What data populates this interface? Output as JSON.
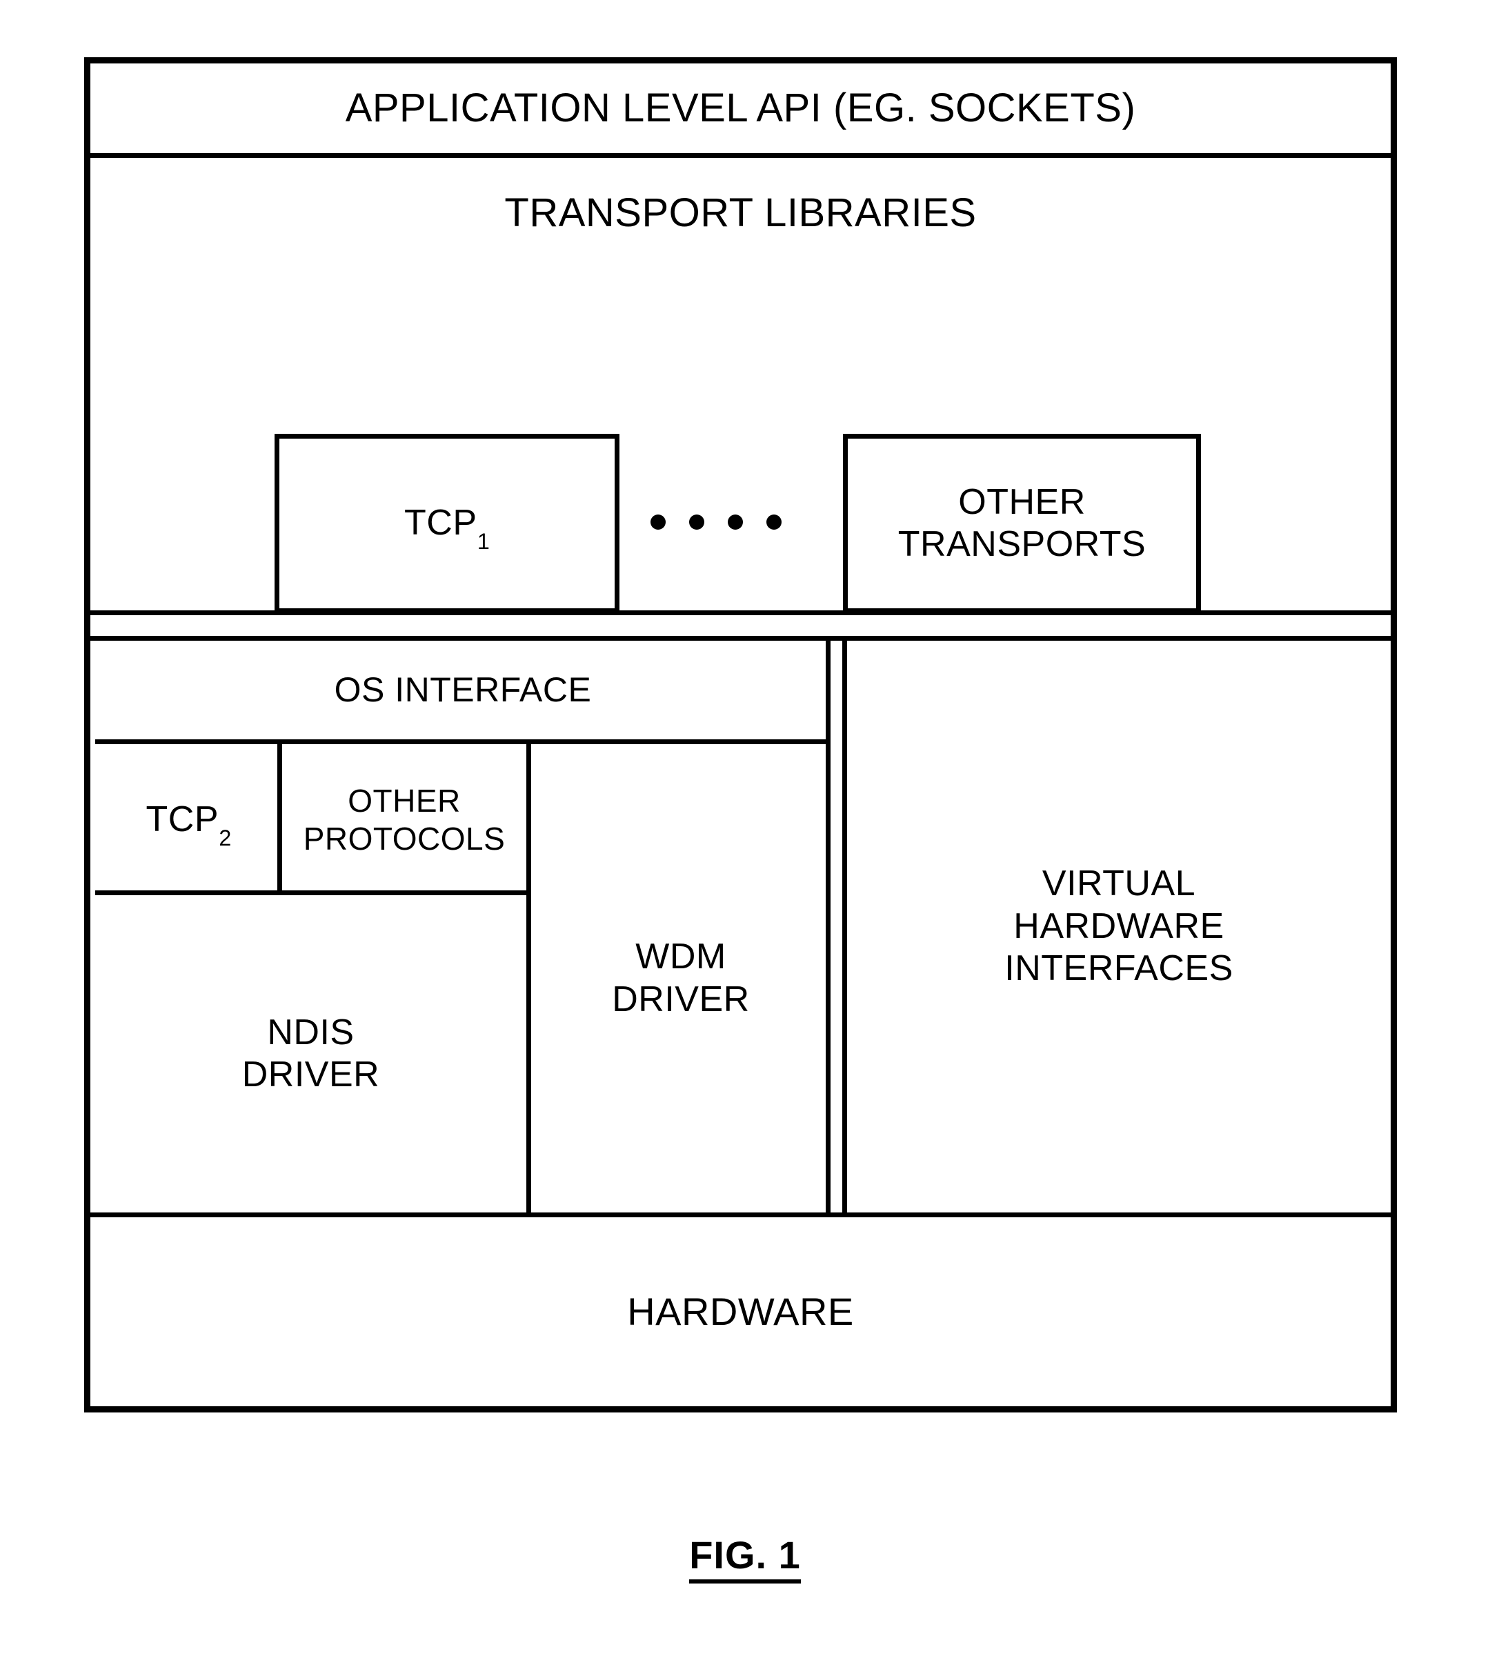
{
  "figure": {
    "caption": "FIG. 1",
    "colors": {
      "line": "#000000",
      "background": "#ffffff"
    }
  },
  "layers": {
    "application_api": {
      "label": "APPLICATION LEVEL API (EG. SOCKETS)"
    },
    "transport_libraries": {
      "label": "TRANSPORT LIBRARIES",
      "boxes": {
        "tcp1": {
          "name": "TCP",
          "subscript": "1"
        },
        "ellipsis": {
          "label": "....",
          "dot_count": 4
        },
        "other_transports": {
          "label": "OTHER\nTRANSPORTS"
        }
      }
    },
    "os_interface": {
      "label": "OS INTERFACE",
      "boxes": {
        "tcp2": {
          "name": "TCP",
          "subscript": "2"
        },
        "other_protocols": {
          "label": "OTHER\nPROTOCOLS"
        },
        "ndis_driver": {
          "label": "NDIS\nDRIVER"
        },
        "wdm_driver": {
          "label": "WDM\nDRIVER"
        }
      }
    },
    "virtual_hardware": {
      "label": "VIRTUAL\nHARDWARE\nINTERFACES"
    },
    "hardware": {
      "label": "HARDWARE"
    }
  }
}
